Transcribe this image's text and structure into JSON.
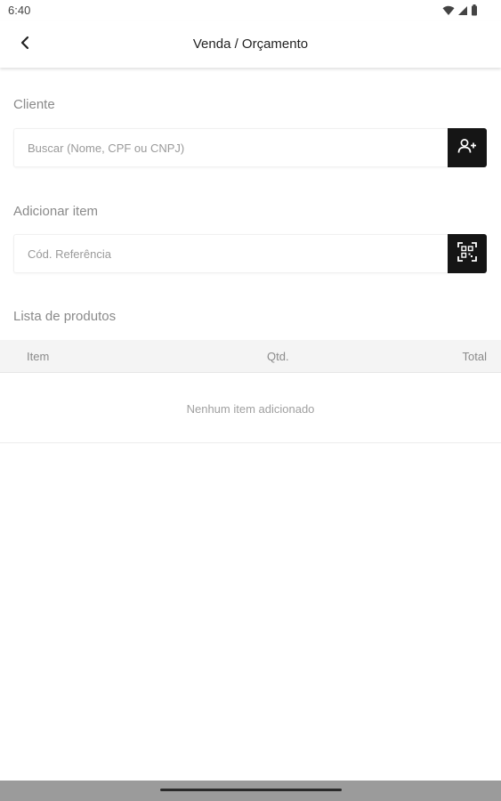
{
  "status_bar": {
    "time": "6:40",
    "icons": [
      "wifi-icon",
      "signal-icon",
      "battery-icon"
    ]
  },
  "app_bar": {
    "back_icon": "back-arrow-icon",
    "title": "Venda / Orçamento"
  },
  "cliente": {
    "label": "Cliente",
    "search_placeholder": "Buscar (Nome, CPF ou CNPJ)",
    "search_value": "",
    "button_icon": "add-user-icon"
  },
  "adicionar_item": {
    "label": "Adicionar item",
    "reference_placeholder": "Cód. Referência",
    "reference_value": "",
    "button_icon": "qr-scan-icon"
  },
  "produtos": {
    "label": "Lista de produtos",
    "columns": [
      "Item",
      "Qtd.",
      "Total"
    ],
    "rows": [],
    "empty_message": "Nenhum item adicionado"
  },
  "colors": {
    "button_bg": "#151515",
    "header_bg": "#f4f4f4",
    "label_text": "#8a8a8a",
    "nav_bar": "#9b9b9b"
  }
}
